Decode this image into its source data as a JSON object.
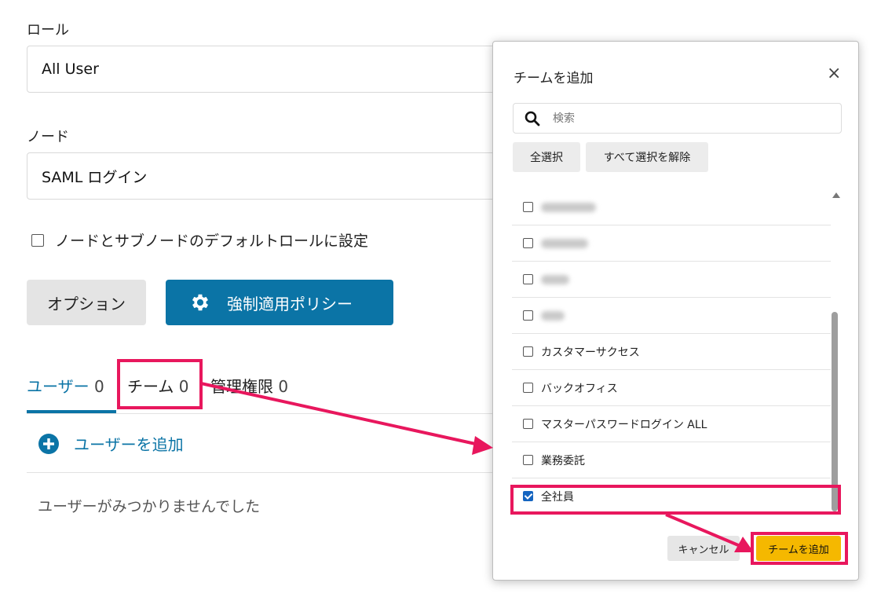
{
  "form": {
    "role_label": "ロール",
    "role_value": "All User",
    "node_label": "ノード",
    "node_value": "SAML ログイン",
    "default_role_checkbox_label": "ノードとサブノードのデフォルトロールに設定",
    "options_button": "オプション",
    "policy_button": "強制適用ポリシー"
  },
  "tabs": [
    {
      "label": "ユーザー",
      "count": "0"
    },
    {
      "label": "チーム",
      "count": "0"
    },
    {
      "label": "管理権限",
      "count": "0"
    }
  ],
  "add_user_label": "ユーザーを追加",
  "empty_message": "ユーザーがみつかりませんでした",
  "modal": {
    "title": "チームを追加",
    "close_glyph": "×",
    "search_placeholder": "検索",
    "select_all": "全選択",
    "deselect_all": "すべて選択を解除",
    "items": [
      {
        "label": "",
        "blurred": true,
        "checked": false
      },
      {
        "label": "",
        "blurred": true,
        "checked": false
      },
      {
        "label": "",
        "blurred": true,
        "checked": false
      },
      {
        "label": "",
        "blurred": true,
        "checked": false
      },
      {
        "label": "カスタマーサクセス",
        "checked": false
      },
      {
        "label": "バックオフィス",
        "checked": false
      },
      {
        "label": "マスターパスワードログイン ALL",
        "checked": false
      },
      {
        "label": "業務委託",
        "checked": false
      },
      {
        "label": "全社員",
        "checked": true
      }
    ],
    "cancel_button": "キャンセル",
    "add_button": "チームを追加"
  },
  "colors": {
    "primary": "#0b74a6",
    "highlight": "#e8175d",
    "add_button": "#f5b800",
    "checkbox_checked": "#1565c0"
  },
  "icons": {
    "policy": "gear-icon",
    "add_user": "plus-circle-icon",
    "search": "search-icon",
    "close": "close-icon"
  }
}
